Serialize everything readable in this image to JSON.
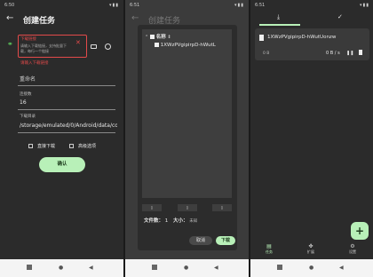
{
  "panel1": {
    "status_time": "6:50",
    "status_icons": "▾▮▮",
    "back_icon": "←",
    "title": "创建任务",
    "link_label": "下载链接",
    "link_placeholder": "请输入下载链接，支持批量下载，每行一个链接",
    "link_error": "请输入下载链接",
    "rename_placeholder": "重命名",
    "threads_label": "连接数",
    "threads_value": "16",
    "dir_label": "下载目录",
    "dir_value": "/storage/emulated/0/Android/data/co",
    "direct_download_label": "直接下载",
    "advanced_label": "高级选项",
    "confirm_label": "确认"
  },
  "panel2": {
    "status_time": "6:51",
    "status_icons": "▾▮▮",
    "title": "创建任务",
    "sort_label": "名称",
    "sort_icon": "⇕",
    "file_name": "1XWzPVgipirpD-hWutL",
    "file_count_label": "文件数：",
    "file_count": "1",
    "size_label": "大小：",
    "size_value": "未知",
    "cancel_label": "取消",
    "download_label": "下载"
  },
  "panel3": {
    "status_time": "6:51",
    "status_icons": "▾▮▮",
    "task_name": "1XWzPVgipirpD-hWutUonzw",
    "task_size": "0 B",
    "task_speed": "0 B / s",
    "fab_label": "+",
    "nav_tasks": "任务",
    "nav_extensions": "扩展",
    "nav_settings": "设置"
  },
  "colors": {
    "accent_green": "#b8f0b8",
    "error_red": "#e24a4a",
    "background": "#2b2b2b"
  }
}
